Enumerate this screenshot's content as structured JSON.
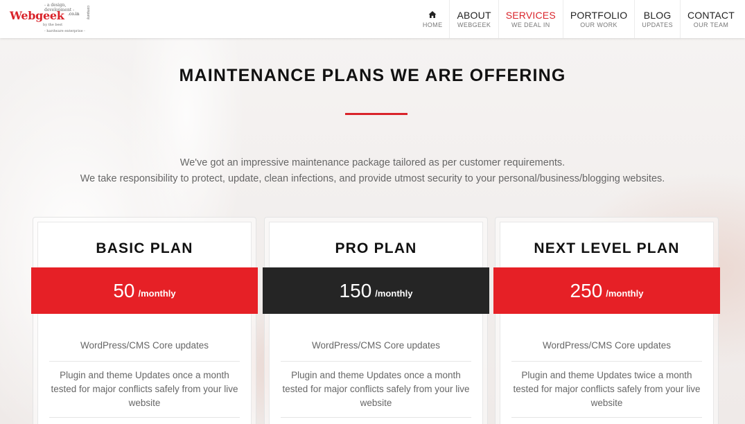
{
  "logo": {
    "name": "Webgeek",
    "domain_suffix": ".co.in",
    "tagline_top": "- a design, development -",
    "tagline_mid": "by the best",
    "tagline_bottom": "- hardware enterprise -",
    "tagline_vertical": "company"
  },
  "nav": [
    {
      "label": "",
      "sub": "HOME",
      "icon": "home-icon",
      "active": false
    },
    {
      "label": "ABOUT",
      "sub": "WEBGEEK",
      "active": false
    },
    {
      "label": "SERVICES",
      "sub": "WE DEAL IN",
      "active": true
    },
    {
      "label": "PORTFOLIO",
      "sub": "OUR WORK",
      "active": false
    },
    {
      "label": "BLOG",
      "sub": "UPDATES",
      "active": false
    },
    {
      "label": "CONTACT",
      "sub": "OUR TEAM",
      "active": false
    }
  ],
  "section": {
    "title": "MAINTENANCE PLANS WE ARE OFFERING",
    "intro_line1": "We've got an impressive maintenance package tailored as per customer requirements.",
    "intro_line2": "We take responsibility to protect, update, clean infections, and provide utmost security to your personal/business/blogging websites."
  },
  "plans": [
    {
      "name": "BASIC PLAN",
      "price": "50",
      "period": "/monthly",
      "band_color": "#e62026",
      "features": [
        "WordPress/CMS Core updates",
        "Plugin and theme Updates once a month tested for major conflicts safely from your live website"
      ]
    },
    {
      "name": "PRO PLAN",
      "price": "150",
      "period": "/monthly",
      "band_color": "#252525",
      "features": [
        "WordPress/CMS Core updates",
        "Plugin and theme Updates once a month tested for major conflicts safely from your live website"
      ]
    },
    {
      "name": "NEXT LEVEL PLAN",
      "price": "250",
      "period": "/monthly",
      "band_color": "#e62026",
      "features": [
        "WordPress/CMS Core updates",
        "Plugin and theme Updates twice a month tested for major conflicts safely from your live website"
      ]
    }
  ],
  "colors": {
    "accent": "#d9232a"
  }
}
